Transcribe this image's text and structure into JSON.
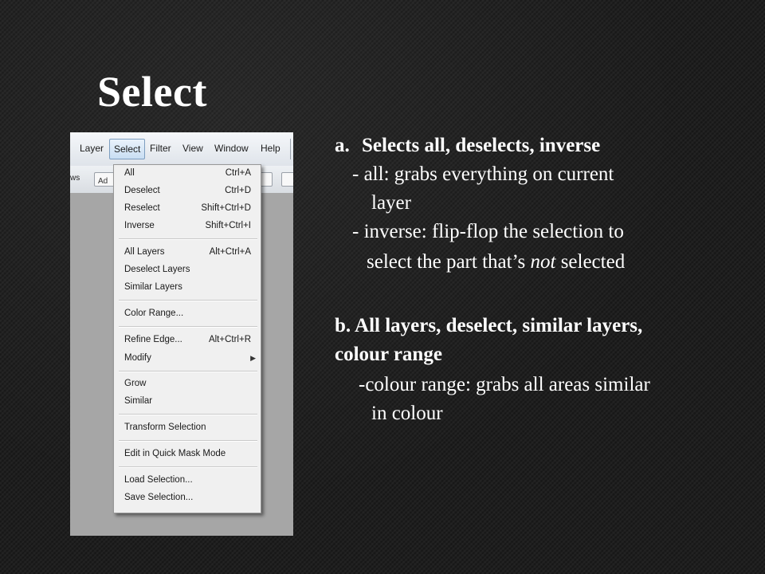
{
  "slide": {
    "title": "Select"
  },
  "menubar": {
    "items": [
      "Layer",
      "Select",
      "Filter",
      "View",
      "Window",
      "Help"
    ]
  },
  "optionsbar": {
    "label": "ws",
    "field_text": "Ad"
  },
  "select_menu": {
    "items": [
      {
        "label": "All",
        "shortcut": "Ctrl+A"
      },
      {
        "label": "Deselect",
        "shortcut": "Ctrl+D"
      },
      {
        "label": "Reselect",
        "shortcut": "Shift+Ctrl+D"
      },
      {
        "label": "Inverse",
        "shortcut": "Shift+Ctrl+I"
      },
      {
        "label": "All Layers",
        "shortcut": "Alt+Ctrl+A"
      },
      {
        "label": "Deselect Layers",
        "shortcut": ""
      },
      {
        "label": "Similar Layers",
        "shortcut": ""
      },
      {
        "label": "Color Range...",
        "shortcut": ""
      },
      {
        "label": "Refine Edge...",
        "shortcut": "Alt+Ctrl+R"
      },
      {
        "label": "Modify",
        "shortcut": ""
      },
      {
        "label": "Grow",
        "shortcut": ""
      },
      {
        "label": "Similar",
        "shortcut": ""
      },
      {
        "label": "Transform Selection",
        "shortcut": ""
      },
      {
        "label": "Edit in Quick Mask Mode",
        "shortcut": ""
      },
      {
        "label": "Load Selection...",
        "shortcut": ""
      },
      {
        "label": "Save Selection...",
        "shortcut": ""
      }
    ]
  },
  "notes": {
    "a_marker": "a.",
    "a_heading": "Selects all, deselects, inverse",
    "a_line1": "- all: grabs everything on current",
    "a_line2": "layer",
    "a_line3": "- inverse: flip-flop the selection to",
    "a_line4_pre": "select the part that’s ",
    "a_line4_em": "not",
    "a_line4_post": " selected",
    "b_heading1": "b. All layers, deselect, similar layers,",
    "b_heading2": "colour range",
    "b_line1": "-colour range: grabs all areas similar",
    "b_line2": "in colour"
  }
}
